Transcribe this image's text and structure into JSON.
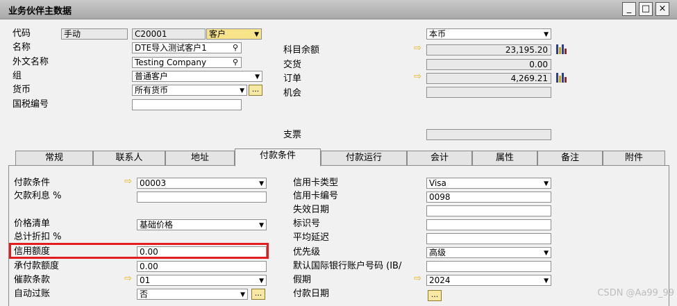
{
  "window": {
    "title": "业务伙伴主数据",
    "minimize": "_",
    "maximize": "□",
    "close": "×"
  },
  "header": {
    "code_label": "代码",
    "code_mode": "手动",
    "code_value": "C20001",
    "bp_type": "客户",
    "name_label": "名称",
    "name_value": "DTE导入测试客户1",
    "foreign_name_label": "外文名称",
    "foreign_name_value": "Testing Company",
    "group_label": "组",
    "group_value": "普通客户",
    "currency_label": "货币",
    "currency_value": "所有货币",
    "tax_label": "国税编号",
    "tax_value": "",
    "local_currency": "本币",
    "balance_label": "科目余额",
    "balance_value": "23,195.20",
    "delivery_label": "交货",
    "delivery_value": "0.00",
    "orders_label": "订单",
    "orders_value": "4,269.21",
    "opportunity_label": "机会",
    "opportunity_value": "",
    "checks_label": "支票",
    "checks_value": "",
    "ellipsis": "..."
  },
  "tabs": [
    "常规",
    "联系人",
    "地址",
    "付款条件",
    "付款运行",
    "会计",
    "属性",
    "备注",
    "附件"
  ],
  "payment": {
    "terms_label": "付款条件",
    "terms_value": "00003",
    "interest_label": "欠款利息 %",
    "interest_value": "",
    "pricelist_label": "价格清单",
    "pricelist_value": "基础价格",
    "discount_label": "总计折扣 %",
    "credit_label": "信用额度",
    "credit_value": "0.00",
    "commit_label": "承付款额度",
    "commit_value": "0.00",
    "dunning_label": "催款条款",
    "dunning_value": "01",
    "autoclose_label": "自动过账",
    "autoclose_value": "否",
    "cardtype_label": "信用卡类型",
    "cardtype_value": "Visa",
    "cardno_label": "信用卡编号",
    "cardno_value": "0098",
    "expiry_label": "失效日期",
    "expiry_value": "",
    "id_label": "标识号",
    "id_value": "",
    "avgdelay_label": "平均延迟",
    "avgdelay_value": "",
    "priority_label": "优先级",
    "priority_value": "高级",
    "iban_label": "默认国际银行账户号码 (IB/",
    "iban_value": "",
    "holiday_label": "假期",
    "holiday_value": "2024",
    "paydate_label": "付款日期"
  },
  "watermark": "CSDN @Aa99_99",
  "colors": {
    "arrow": "#e3b31b",
    "highlight": "#e31d1d"
  }
}
